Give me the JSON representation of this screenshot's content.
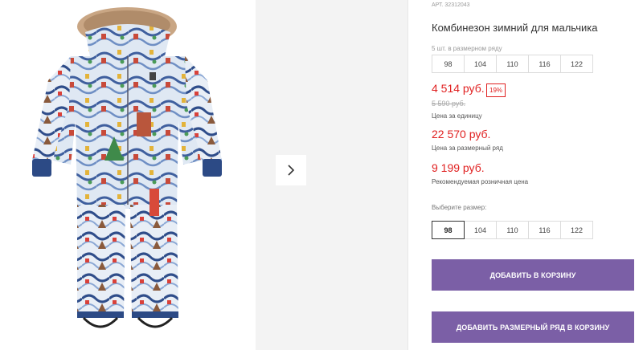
{
  "product": {
    "article": "АРТ. 32312043",
    "title": "Комбинезон зимний для мальчика",
    "image_icon": "snowsuit-image"
  },
  "pack": {
    "caption": "5 шт. в размерном ряду",
    "sizes": [
      "98",
      "104",
      "110",
      "116",
      "122"
    ]
  },
  "prices": {
    "unit_price": "4 514 руб.",
    "discount_badge": "19%",
    "old_price": "5 590 руб.",
    "unit_label": "Цена за единицу",
    "pack_price": "22 570 руб.",
    "pack_label": "Цена за размерный ряд",
    "retail_price": "9 199 руб.",
    "retail_label": "Рекомендуемая розничная цена"
  },
  "size_select": {
    "caption": "Выберите размер:",
    "options": [
      "98",
      "104",
      "110",
      "116",
      "122"
    ],
    "selected": "98"
  },
  "buttons": {
    "add_to_cart": "ДОБАВИТЬ В КОРЗИНУ",
    "add_pack_to_cart": "ДОБАВИТЬ РАЗМЕРНЫЙ РЯД В КОРЗИНУ"
  },
  "gallery": {
    "next_icon": "chevron-right-icon"
  },
  "colors": {
    "price_red": "#e02020",
    "button_purple": "#7b5fa6",
    "thumb_panel_bg": "#f3f3f3"
  }
}
